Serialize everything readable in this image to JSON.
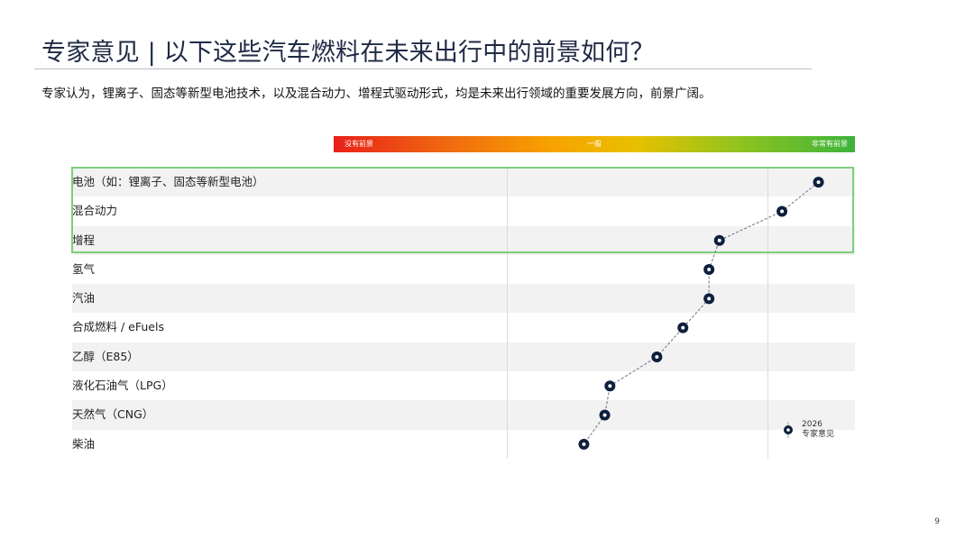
{
  "slide": {
    "title": "专家意见 | 以下这些汽车燃料在未来出行中的前景如何？",
    "subtitle": "专家认为，锂离子、固态等新型电池技术，以及混合动力、增程式驱动形式，均是未来出行领域的重要发展方向，前景广阔。",
    "page_number": "9"
  },
  "scale": {
    "low_label": "没有前景",
    "mid_label": "一般",
    "high_label": "非常有前景"
  },
  "legend": {
    "year": "2026",
    "label": "专家意见"
  },
  "chart_data": {
    "type": "scatter",
    "title": "",
    "xlabel": "",
    "ylabel": "",
    "xlim": [
      0,
      100
    ],
    "grid": false,
    "categories": [
      "电池（如：锂离子、固态等新型电池）",
      "混合动力",
      "增程",
      "氢气",
      "汽油",
      "合成燃料 / eFuels",
      "乙醇（E85）",
      "液化石油气（LPG）",
      "天然气（CNG）",
      "柴油"
    ],
    "series": [
      {
        "name": "2026 专家意见",
        "values": [
          93,
          86,
          74,
          72,
          72,
          67,
          62,
          53,
          52,
          48
        ]
      }
    ],
    "highlighted_categories": [
      "电池（如：锂离子、固态等新型电池）",
      "混合动力",
      "增程"
    ],
    "colors": {
      "marker": "#0e1f3d",
      "highlight_border": "#7ccf7a",
      "scale_start": "#e8201a",
      "scale_end": "#3cb43c"
    }
  }
}
